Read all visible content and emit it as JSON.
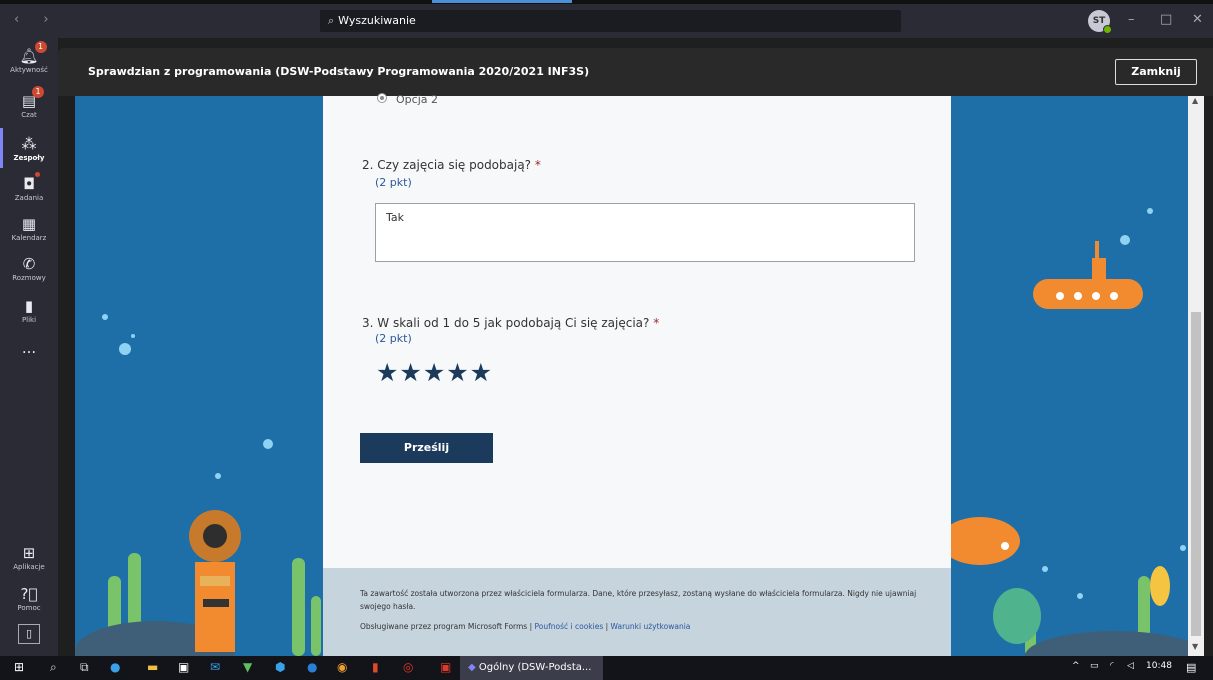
{
  "titlebar": {
    "nav": "‹ ›",
    "search_icon": "search-icon",
    "search_value": "Wyszukiwanie",
    "avatar_initials": "ST",
    "minimize": "–",
    "maximize": "□",
    "close": "✕"
  },
  "rail": {
    "items": [
      {
        "label": "Aktywność",
        "icon": "bell-icon",
        "badge": "1"
      },
      {
        "label": "Czat",
        "icon": "chat-icon",
        "badge": "1"
      },
      {
        "label": "Zespoły",
        "icon": "teams-icon"
      },
      {
        "label": "Zadania",
        "icon": "assignments-icon"
      },
      {
        "label": "Kalendarz",
        "icon": "calendar-icon"
      },
      {
        "label": "Rozmowy",
        "icon": "phone-icon"
      },
      {
        "label": "Pliki",
        "icon": "file-icon"
      },
      {
        "label": "...",
        "icon": "more-icon"
      },
      {
        "label": "Aplikacje",
        "icon": "apps-icon"
      },
      {
        "label": "Pomoc",
        "icon": "help-icon"
      }
    ]
  },
  "appbar": {
    "title": "Sprawdzian z programowania (DSW-Podstawy Programowania 2020/2021 INF3S)",
    "close_label": "Zamknij"
  },
  "form": {
    "prev_option": "Opcja 2",
    "q2": {
      "text": "2. Czy zajęcia się podobają?",
      "req": "*",
      "points": "(2 pkt)",
      "answer": "Tak"
    },
    "q3": {
      "text": "3. W skali od 1 do 5 jak podobają Ci się zajęcia?",
      "req": "*",
      "points": "(2 pkt)",
      "rating": 5,
      "stars": "★★★★★"
    },
    "submit_label": "Prześlij",
    "disclaimer": "Ta zawartość została utworzona przez właściciela formularza. Dane, które przesyłasz, zostaną wysłane do właściciela formularza. Nigdy nie ujawniaj swojego hasła.",
    "powered_by": "Obsługiwane przez program Microsoft Forms |",
    "privacy_link": "Poufność i cookies",
    "sep": "|",
    "terms_link": "Warunki użytkowania"
  },
  "taskbar": {
    "active_task": "Ogólny (DSW-Podsta...",
    "time": "10:48"
  },
  "colors": {
    "rail_bg": "#2b2b36",
    "scene_bg": "#1e6fa8",
    "submit_bg": "#1b3a5c",
    "accent": "#7f85f5"
  }
}
